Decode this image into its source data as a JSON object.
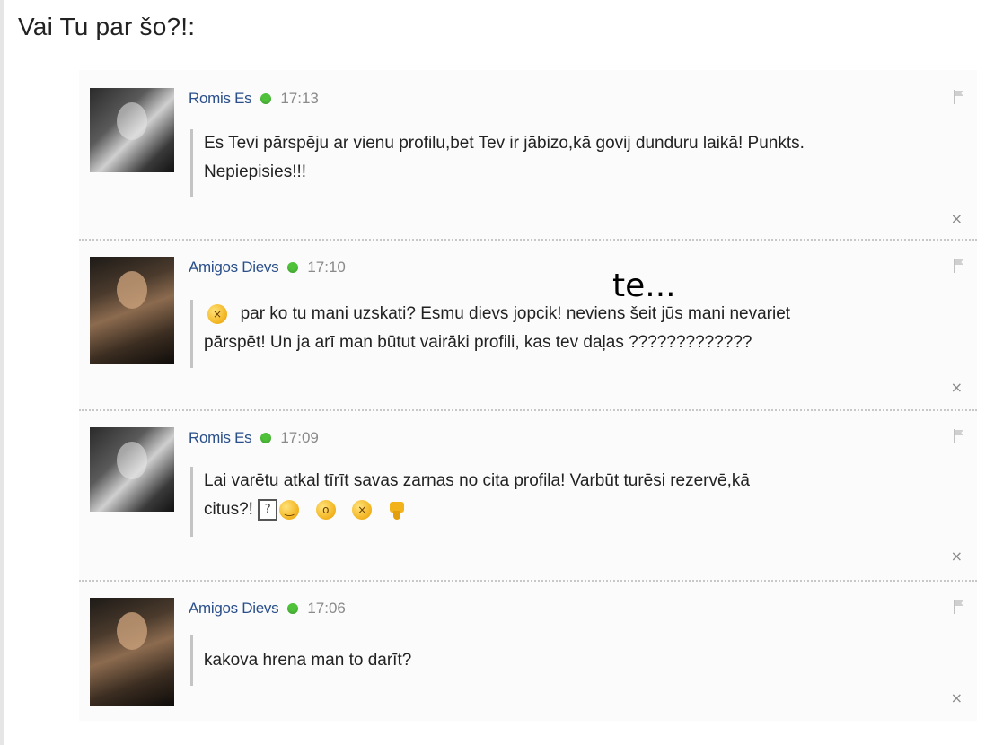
{
  "page": {
    "heading": "Vai Tu par šo?!:",
    "overlay_note": "te..."
  },
  "colors": {
    "author_link": "#2a4f8a",
    "online_status": "#4fc23a",
    "timestamp": "#8a8a8a"
  },
  "posts": [
    {
      "author": "Romis Es",
      "time": "17:13",
      "lines": [
        "Es Tevi pārspēju ar vienu profilu,bet Tev ir jābizo,kā govij dunduru laikā! Punkts.",
        "Nepiepisies!!!"
      ],
      "avatar": "avatar-romis"
    },
    {
      "author": "Amigos Dievs",
      "time": "17:10",
      "lines": [
        "par ko tu mani uzskati? Esmu dievs jopcik! neviens šeit jūs mani nevariet",
        "pārspēt! Un ja arī man būtut vairāki profili, kas tev daļas ?????????????"
      ],
      "avatar": "avatar-amigos"
    },
    {
      "author": "Romis Es",
      "time": "17:09",
      "lines": [
        "Lai varētu atkal tīrīt savas zarnas no cita profila! Varbūt turēsi rezervē,kā",
        "citus?!"
      ],
      "avatar": "avatar-romis"
    },
    {
      "author": "Amigos Dievs",
      "time": "17:06",
      "lines": [
        "kakova hrena man to darīt?"
      ],
      "avatar": "avatar-amigos"
    }
  ],
  "icons": {
    "flag": "flag-icon",
    "close": "close-icon",
    "close_glyph": "×",
    "status": "online-status-icon",
    "question_box": "?"
  }
}
